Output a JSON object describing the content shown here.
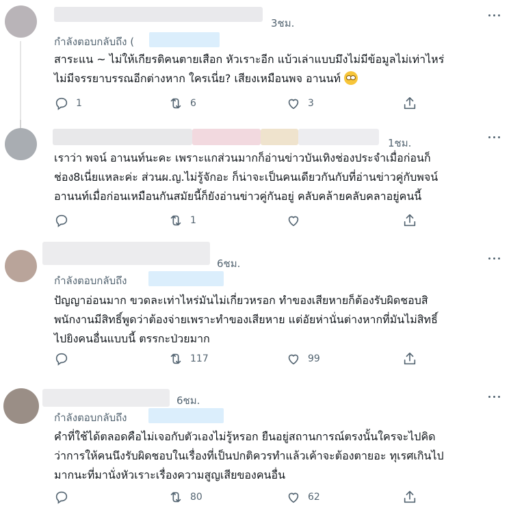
{
  "colors": {
    "text": "#0f1419",
    "muted": "#536471",
    "mention": "#dbeefc",
    "divider": "#eff3f4"
  },
  "tweets": [
    {
      "time": "3ชม.",
      "reply_label": "กำลังตอบกลับถึง",
      "reply_prefix": "(",
      "text": "สาระแน ~ ไม่ให้เกียรติคนตายเสือก หัวเราะอีก แบ้วเล่าแบบมึงไม่มีข้อมูลไม่เท่าไหร่\nไม่มีจรรยาบรรณอีกต่างหาก ใครเนี่ย? เสียงเหมือนพจ อานนท์",
      "emoji": "face-with-rolling-eyes",
      "reply_count": "1",
      "retweet_count": "6",
      "like_count": "3"
    },
    {
      "time": "1ชม.",
      "text": "เราว่า พจน์ อานนท์นะคะ เพราะแกส่วนมากก็อ่านข่าวบันเทิงช่องประจำเมื่อก่อนก็\nช่อง8เนี่ยแหละค่ะ ส่วนผ.ญ.ไม่รู้จักอะ ก็น่าจะเป็นคนเดียวกันกับที่อ่านข่าวคู่กับพจน์\nอานนท์เมื่อก่อนเหมือนกันสมัยนี้ก็ยังอ่านข่าวคู่กันอยู่ คลับคล้ายคลับคลาอยู่คนนี้",
      "reply_count": "",
      "retweet_count": "1",
      "like_count": ""
    },
    {
      "time": "6ชม.",
      "reply_label": "กำลังตอบกลับถึง",
      "text": "ปัญญาอ่อนมาก ขวดละเท่าไหร่มันไม่เกี่ยวหรอก ทำของเสียหายก็ต้องรับผิดชอบสิ\nพนักงานมีสิทธิ์พูดว่าต้องจ่ายเพราะทำของเสียหาย แต่อัยห่านั่นต่างหากที่มันไม่สิทธิ์\nไปยิงคนอื่นแบบนี้ ตรรกะป่วยมาก",
      "reply_count": "",
      "retweet_count": "117",
      "like_count": "99"
    },
    {
      "time": "6ชม.",
      "reply_label": "กำลังตอบกลับถึง",
      "text": "คำที่ใช้ได้ตลอดคือไม่เจอกับตัวเองไม่รู้หรอก ยืนอยู่สถานการณ์ตรงนั้นใครจะไปคิด\nว่าการให้คนนึงรับผิดชอบในเรื่องที่เป็นปกติควรทำแล้วเค้าจะต้องตายอะ ทุเรศเกินไป\nมากนะที่มานั่งหัวเราะเรื่องความสูญเสียของคนอื่น",
      "reply_count": "",
      "retweet_count": "80",
      "like_count": "62"
    }
  ]
}
